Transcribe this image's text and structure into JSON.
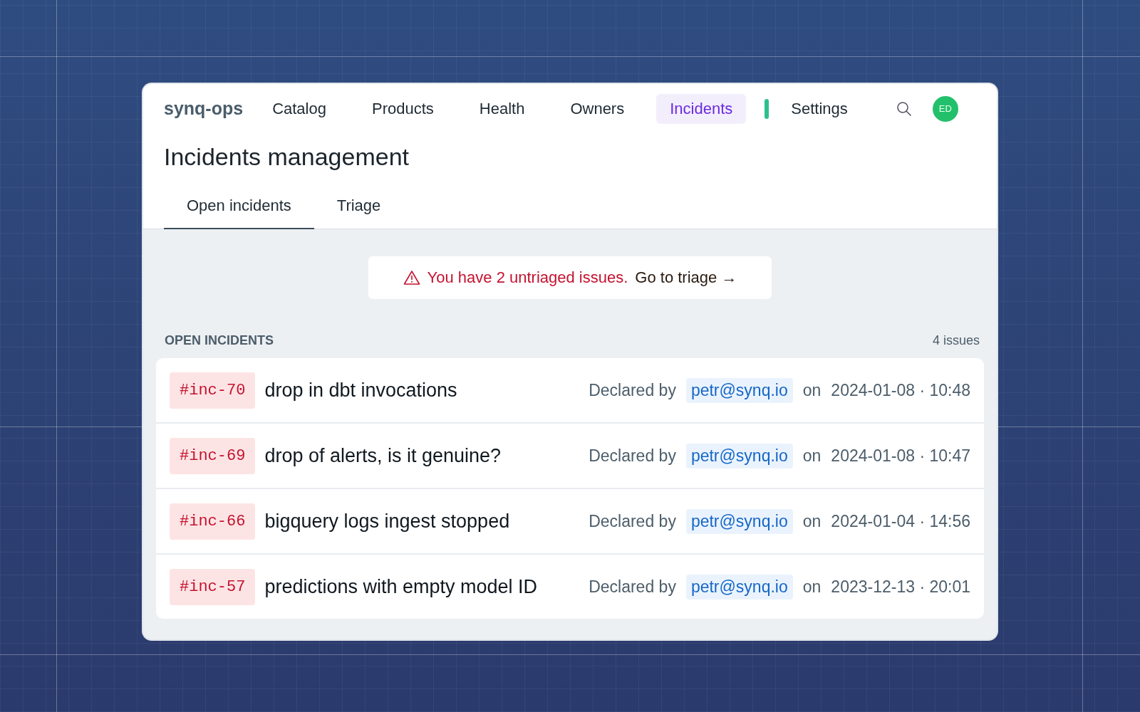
{
  "nav": {
    "brand": "synq-ops",
    "items": [
      {
        "label": "Catalog",
        "selected": false,
        "indicator": false
      },
      {
        "label": "Products",
        "selected": false,
        "indicator": false
      },
      {
        "label": "Health",
        "selected": false,
        "indicator": false
      },
      {
        "label": "Owners",
        "selected": false,
        "indicator": false
      },
      {
        "label": "Incidents",
        "selected": true,
        "indicator": false
      },
      {
        "label": "Settings",
        "selected": false,
        "indicator": true
      }
    ],
    "avatar": "ED"
  },
  "page_title": "Incidents management",
  "tabs": [
    {
      "label": "Open incidents",
      "selected": true
    },
    {
      "label": "Triage",
      "selected": false
    }
  ],
  "banner": {
    "message": "You have 2 untriaged issues.",
    "link": "Go to triage →"
  },
  "section": {
    "title": "OPEN INCIDENTS",
    "count": "4 issues"
  },
  "incidents": [
    {
      "id": "#inc-70",
      "title": "drop in dbt invocations",
      "declared_label": "Declared by",
      "user": "petr@synq.io",
      "on_label": "on",
      "date": "2024-01-08 · 10:48"
    },
    {
      "id": "#inc-69",
      "title": "drop of alerts, is it genuine?",
      "declared_label": "Declared by",
      "user": "petr@synq.io",
      "on_label": "on",
      "date": "2024-01-08 · 10:47"
    },
    {
      "id": "#inc-66",
      "title": "bigquery logs ingest stopped",
      "declared_label": "Declared by",
      "user": "petr@synq.io",
      "on_label": "on",
      "date": "2024-01-04 · 14:56"
    },
    {
      "id": "#inc-57",
      "title": "predictions with empty model ID",
      "declared_label": "Declared by",
      "user": "petr@synq.io",
      "on_label": "on",
      "date": "2023-12-13 · 20:01"
    }
  ]
}
